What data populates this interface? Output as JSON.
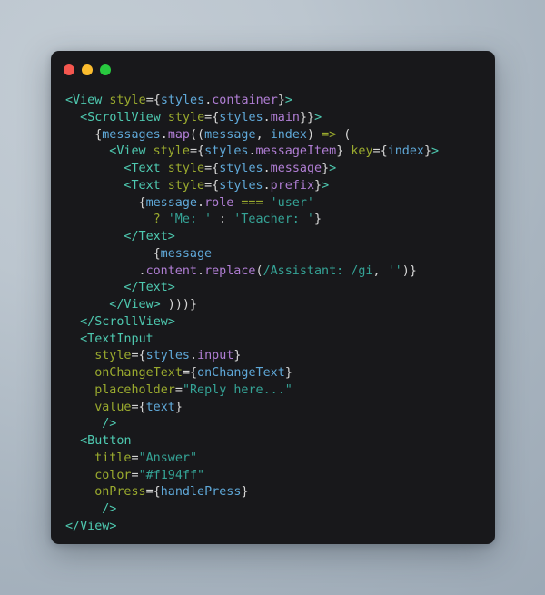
{
  "window": {
    "title_bar": {
      "buttons": [
        {
          "name": "close",
          "color": "#f4564f"
        },
        {
          "name": "minimize",
          "color": "#fbbc2e"
        },
        {
          "name": "maximize",
          "color": "#28c93f"
        }
      ]
    },
    "background": "#18181b"
  },
  "theme": {
    "tag": "#4ec9b0",
    "attribute": "#9aaa2e",
    "variable": "#5fa8d8",
    "property": "#b07ed4",
    "string": "#35a396",
    "punctuation": "#d6d6d6",
    "page_background": "#b4bfc9"
  },
  "code": {
    "language": "jsx",
    "lines": [
      {
        "indent": 0,
        "tokens": [
          {
            "t": "tag",
            "v": "<View"
          },
          {
            "t": "punc",
            "v": " "
          },
          {
            "t": "attr",
            "v": "style"
          },
          {
            "t": "punc",
            "v": "={"
          },
          {
            "t": "var",
            "v": "styles"
          },
          {
            "t": "punc",
            "v": "."
          },
          {
            "t": "prop",
            "v": "container"
          },
          {
            "t": "punc",
            "v": "}"
          },
          {
            "t": "tag",
            "v": ">"
          }
        ]
      },
      {
        "indent": 1,
        "tokens": [
          {
            "t": "tag",
            "v": "<ScrollView"
          },
          {
            "t": "punc",
            "v": " "
          },
          {
            "t": "attr",
            "v": "style"
          },
          {
            "t": "punc",
            "v": "={"
          },
          {
            "t": "var",
            "v": "styles"
          },
          {
            "t": "punc",
            "v": "."
          },
          {
            "t": "prop",
            "v": "main"
          },
          {
            "t": "punc",
            "v": "}}"
          },
          {
            "t": "tag",
            "v": ">"
          }
        ]
      },
      {
        "indent": 2,
        "tokens": [
          {
            "t": "punc",
            "v": "{"
          },
          {
            "t": "var",
            "v": "messages"
          },
          {
            "t": "punc",
            "v": "."
          },
          {
            "t": "prop",
            "v": "map"
          },
          {
            "t": "punc",
            "v": "(("
          },
          {
            "t": "var",
            "v": "message"
          },
          {
            "t": "punc",
            "v": ", "
          },
          {
            "t": "var",
            "v": "index"
          },
          {
            "t": "punc",
            "v": ") "
          },
          {
            "t": "op",
            "v": "=>"
          },
          {
            "t": "punc",
            "v": " ("
          }
        ]
      },
      {
        "indent": 3,
        "tokens": [
          {
            "t": "tag",
            "v": "<View"
          },
          {
            "t": "punc",
            "v": " "
          },
          {
            "t": "attr",
            "v": "style"
          },
          {
            "t": "punc",
            "v": "={"
          },
          {
            "t": "var",
            "v": "styles"
          },
          {
            "t": "punc",
            "v": "."
          },
          {
            "t": "prop",
            "v": "messageItem"
          },
          {
            "t": "punc",
            "v": "} "
          },
          {
            "t": "attr",
            "v": "key"
          },
          {
            "t": "punc",
            "v": "={"
          },
          {
            "t": "var",
            "v": "index"
          },
          {
            "t": "punc",
            "v": "}"
          },
          {
            "t": "tag",
            "v": ">"
          }
        ]
      },
      {
        "indent": 4,
        "tokens": [
          {
            "t": "tag",
            "v": "<Text"
          },
          {
            "t": "punc",
            "v": " "
          },
          {
            "t": "attr",
            "v": "style"
          },
          {
            "t": "punc",
            "v": "={"
          },
          {
            "t": "var",
            "v": "styles"
          },
          {
            "t": "punc",
            "v": "."
          },
          {
            "t": "prop",
            "v": "message"
          },
          {
            "t": "punc",
            "v": "}"
          },
          {
            "t": "tag",
            "v": ">"
          }
        ]
      },
      {
        "indent": 4,
        "tokens": [
          {
            "t": "tag",
            "v": "<Text"
          },
          {
            "t": "punc",
            "v": " "
          },
          {
            "t": "attr",
            "v": "style"
          },
          {
            "t": "punc",
            "v": "={"
          },
          {
            "t": "var",
            "v": "styles"
          },
          {
            "t": "punc",
            "v": "."
          },
          {
            "t": "prop",
            "v": "prefix"
          },
          {
            "t": "punc",
            "v": "}"
          },
          {
            "t": "tag",
            "v": ">"
          }
        ]
      },
      {
        "indent": 5,
        "tokens": [
          {
            "t": "punc",
            "v": "{"
          },
          {
            "t": "var",
            "v": "message"
          },
          {
            "t": "punc",
            "v": "."
          },
          {
            "t": "prop",
            "v": "role"
          },
          {
            "t": "punc",
            "v": " "
          },
          {
            "t": "op",
            "v": "==="
          },
          {
            "t": "punc",
            "v": " "
          },
          {
            "t": "str",
            "v": "'user'"
          }
        ]
      },
      {
        "indent": 6,
        "tokens": [
          {
            "t": "op",
            "v": "?"
          },
          {
            "t": "punc",
            "v": " "
          },
          {
            "t": "str",
            "v": "'Me: '"
          },
          {
            "t": "punc",
            "v": " : "
          },
          {
            "t": "str",
            "v": "'Teacher: '"
          },
          {
            "t": "punc",
            "v": "}"
          }
        ]
      },
      {
        "indent": 4,
        "tokens": [
          {
            "t": "tag",
            "v": "</Text>"
          }
        ]
      },
      {
        "indent": 6,
        "tokens": [
          {
            "t": "punc",
            "v": "{"
          },
          {
            "t": "var",
            "v": "message"
          }
        ]
      },
      {
        "indent": 5,
        "tokens": [
          {
            "t": "punc",
            "v": "."
          },
          {
            "t": "prop",
            "v": "content"
          },
          {
            "t": "punc",
            "v": "."
          },
          {
            "t": "prop",
            "v": "replace"
          },
          {
            "t": "punc",
            "v": "("
          },
          {
            "t": "str",
            "v": "/Assistant: /gi"
          },
          {
            "t": "punc",
            "v": ", "
          },
          {
            "t": "str",
            "v": "''"
          },
          {
            "t": "punc",
            "v": ")}"
          }
        ]
      },
      {
        "indent": 4,
        "tokens": [
          {
            "t": "tag",
            "v": "</Text>"
          }
        ]
      },
      {
        "indent": 3,
        "tokens": [
          {
            "t": "tag",
            "v": "</View>"
          },
          {
            "t": "punc",
            "v": " )))}"
          }
        ]
      },
      {
        "indent": 1,
        "tokens": [
          {
            "t": "tag",
            "v": "</ScrollView>"
          }
        ]
      },
      {
        "indent": 1,
        "tokens": [
          {
            "t": "tag",
            "v": "<TextInput"
          }
        ]
      },
      {
        "indent": 2,
        "tokens": [
          {
            "t": "attr",
            "v": "style"
          },
          {
            "t": "punc",
            "v": "={"
          },
          {
            "t": "var",
            "v": "styles"
          },
          {
            "t": "punc",
            "v": "."
          },
          {
            "t": "prop",
            "v": "input"
          },
          {
            "t": "punc",
            "v": "}"
          }
        ]
      },
      {
        "indent": 2,
        "tokens": [
          {
            "t": "attr",
            "v": "onChangeText"
          },
          {
            "t": "punc",
            "v": "={"
          },
          {
            "t": "var",
            "v": "onChangeText"
          },
          {
            "t": "punc",
            "v": "}"
          }
        ]
      },
      {
        "indent": 2,
        "tokens": [
          {
            "t": "attr",
            "v": "placeholder"
          },
          {
            "t": "punc",
            "v": "="
          },
          {
            "t": "str",
            "v": "\"Reply here...\""
          }
        ]
      },
      {
        "indent": 2,
        "tokens": [
          {
            "t": "attr",
            "v": "value"
          },
          {
            "t": "punc",
            "v": "={"
          },
          {
            "t": "var",
            "v": "text"
          },
          {
            "t": "punc",
            "v": "}"
          }
        ]
      },
      {
        "indent": 2,
        "tokens": [
          {
            "t": "tag",
            "v": "/>"
          }
        ],
        "half": true
      },
      {
        "indent": 1,
        "tokens": [
          {
            "t": "tag",
            "v": "<Button"
          }
        ]
      },
      {
        "indent": 2,
        "tokens": [
          {
            "t": "attr",
            "v": "title"
          },
          {
            "t": "punc",
            "v": "="
          },
          {
            "t": "str",
            "v": "\"Answer\""
          }
        ]
      },
      {
        "indent": 2,
        "tokens": [
          {
            "t": "attr",
            "v": "color"
          },
          {
            "t": "punc",
            "v": "="
          },
          {
            "t": "str",
            "v": "\"#f194ff\""
          }
        ]
      },
      {
        "indent": 2,
        "tokens": [
          {
            "t": "attr",
            "v": "onPress"
          },
          {
            "t": "punc",
            "v": "={"
          },
          {
            "t": "var",
            "v": "handlePress"
          },
          {
            "t": "punc",
            "v": "}"
          }
        ]
      },
      {
        "indent": 2,
        "tokens": [
          {
            "t": "tag",
            "v": "/>"
          }
        ],
        "half": true
      },
      {
        "indent": 0,
        "tokens": [
          {
            "t": "tag",
            "v": "</View>"
          }
        ]
      }
    ]
  }
}
